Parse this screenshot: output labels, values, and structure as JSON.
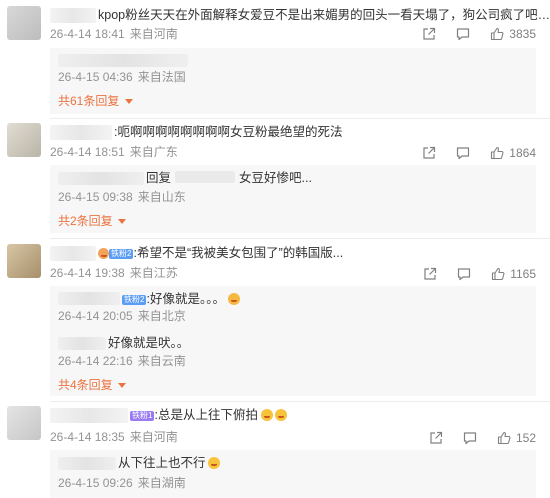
{
  "comments": [
    {
      "text": "kpop粉丝天天在外面解释女爱豆不是出来媚男的回头一看天塌了，狗公司疯了吧……",
      "time": "26-4-14 18:41",
      "location": "来自河南",
      "likes": "3835",
      "replies": [
        {
          "text": "",
          "time": "26-4-15 04:36",
          "location": "来自法国"
        }
      ],
      "more": "共61条回复"
    },
    {
      "text": "呃啊啊啊啊啊啊啊啊女豆粉最绝望的死法",
      "time": "26-4-14 18:51",
      "location": "来自广东",
      "likes": "1864",
      "replies": [
        {
          "text_before": "回复",
          "text_after": "女豆好惨吧...",
          "time": "26-4-15 09:38",
          "location": "来自山东"
        }
      ],
      "more": "共2条回复"
    },
    {
      "badge": "铁粉2",
      "text": "希望不是“我被美女包围了”的韩国版...",
      "time": "26-4-14 19:38",
      "location": "来自江苏",
      "likes": "1165",
      "replies": [
        {
          "badge": "铁粉2",
          "text": "好像就是。。。",
          "time": "26-4-14 20:05",
          "location": "来自北京"
        },
        {
          "text": "好像就是吠。。",
          "time": "26-4-14 22:16",
          "location": "来自云南"
        }
      ],
      "more": "共4条回复"
    },
    {
      "badge": "铁粉1",
      "text": "总是从上往下俯拍",
      "time": "26-4-14 18:35",
      "location": "来自河南",
      "likes": "152",
      "replies": [
        {
          "text": "从下往上也不行",
          "time": "26-4-15 09:26",
          "location": "来自湖南"
        }
      ]
    }
  ],
  "icons": {
    "share": "share-icon",
    "comment": "comment-icon",
    "like": "like-icon",
    "chevron": "chevron-down-icon",
    "emoji": "laughing-emoji-icon"
  },
  "colors": {
    "accent": "#eb7340",
    "meta": "#939393",
    "reply_bg": "#f7f7f7",
    "badge_blue": "#5b9cf5",
    "badge_purple": "#9b7cf0"
  }
}
